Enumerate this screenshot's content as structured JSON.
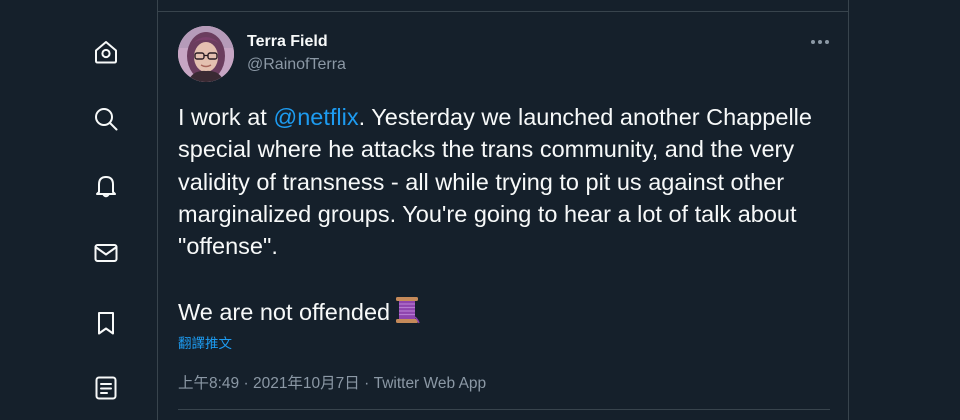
{
  "nav": {
    "items": [
      {
        "name": "home",
        "icon": "home-icon"
      },
      {
        "name": "explore",
        "icon": "search-icon"
      },
      {
        "name": "notifications",
        "icon": "bell-icon"
      },
      {
        "name": "messages",
        "icon": "mail-icon"
      },
      {
        "name": "bookmarks",
        "icon": "bookmark-icon"
      },
      {
        "name": "lists",
        "icon": "list-icon"
      }
    ]
  },
  "tweet": {
    "author": {
      "display_name": "Terra Field",
      "handle": "@RainofTerra",
      "avatar": "avatar-photo"
    },
    "more_icon": "more-icon",
    "text_before_mention": "I work at ",
    "mention": "@netflix",
    "text_after_mention": ". Yesterday we launched another Chappelle special where he attacks the trans community, and the very validity of transness - all while trying to pit us against other marginalized groups. You're going to hear a lot of talk about \"offense\".\n\nWe are not offended",
    "emoji": "spool-of-thread-emoji",
    "translate_label": "翻譯推文",
    "time": "上午8:49",
    "date": "2021年10月7日",
    "separator": " · ",
    "source": "Twitter Web App"
  },
  "colors": {
    "background": "#15202b",
    "border": "#38444d",
    "text": "#f7f9f9",
    "secondary": "#8b98a5",
    "accent": "#1d9bf0"
  }
}
